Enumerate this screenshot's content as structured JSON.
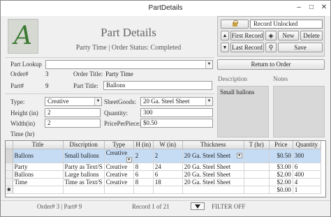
{
  "window": {
    "title": "PartDetails"
  },
  "header": {
    "title": "Part Details",
    "subtitle": "Party Time | Order Status: Completed",
    "logo_letter": "A"
  },
  "record_panel": {
    "lock_status": "Record Unlocked",
    "buttons": {
      "first_record": "First Record",
      "last_record": "Last Record",
      "new": "New",
      "delete": "Delete",
      "save": "Save",
      "return_to_order": "Return to Order"
    }
  },
  "form": {
    "part_lookup_label": "Part Lookup",
    "part_lookup_value": "",
    "order_no_label": "Order#",
    "order_no_value": "3",
    "order_title_label": "Order Title:",
    "order_title_value": "Party Time",
    "part_no_label": "Part#",
    "part_no_value": "9",
    "part_title_label": "Part Title:",
    "part_title_value": "Ballons",
    "type_label": "Type:",
    "type_value": "Creative",
    "sheetgoods_label": "SheetGoods:",
    "sheetgoods_value": "20 Ga. Steel Sheet",
    "height_label": "Height (in)",
    "height_value": "2",
    "quantity_label": "Quantity:",
    "quantity_value": "300",
    "width_label": "Width(in)",
    "width_value": "2",
    "price_per_piece_label": "PricePerPiece:",
    "price_per_piece_value": "$0.50",
    "time_label": "Time (hr)",
    "time_value": "",
    "description_label": "Description",
    "description_value": "Small ballons",
    "notes_label": "Notes",
    "notes_value": ""
  },
  "grid": {
    "columns": [
      "Title",
      "Discription",
      "Type",
      "H (in)",
      "W (in)",
      "Thickness",
      "T (hr)",
      "Price",
      "Quantity"
    ],
    "rows": [
      {
        "marker": "",
        "title": "Ballons",
        "discription": "Small ballons",
        "type": "Creative",
        "h": "2",
        "w": "2",
        "thickness": "20 Ga. Steel Sheet",
        "t": "",
        "price": "$0.50",
        "quantity": "300"
      },
      {
        "marker": "",
        "title": "Party",
        "discription": "Party as Text/S",
        "type": "Creative",
        "h": "8",
        "w": "24",
        "thickness": "20 Ga. Steel Sheet",
        "t": "",
        "price": "$3.00",
        "quantity": "6"
      },
      {
        "marker": "",
        "title": "Ballons",
        "discription": "Large ballons",
        "type": "Creative",
        "h": "6",
        "w": "6",
        "thickness": "20 Ga. Steel Sheet",
        "t": "",
        "price": "$2.00",
        "quantity": "400"
      },
      {
        "marker": "",
        "title": "Time",
        "discription": "Time as Text/S",
        "type": "Creative",
        "h": "8",
        "w": "18",
        "thickness": "20 Ga. Steel Sheet",
        "t": "",
        "price": "$2.00",
        "quantity": "4"
      },
      {
        "marker": "✱",
        "title": "",
        "discription": "",
        "type": "",
        "h": "",
        "w": "",
        "thickness": "",
        "t": "",
        "price": "$0.00",
        "quantity": "1"
      }
    ]
  },
  "statusbar": {
    "order_part": "Order# 3 | Part# 9",
    "record": "Record 1 of 21",
    "filter": "FILTER OFF"
  },
  "icons": {
    "minimize": "minimize-icon",
    "maximize": "maximize-icon",
    "close": "close-icon",
    "lock": "lock-icon",
    "binoculars": "binoculars-icon",
    "search": "search-icon",
    "filter": "filter-icon",
    "first": "triangle-up-icon",
    "last": "triangle-down-icon"
  },
  "colors": {
    "selected_row": "#c6dcf5",
    "logo_green": "#3a7a32"
  }
}
